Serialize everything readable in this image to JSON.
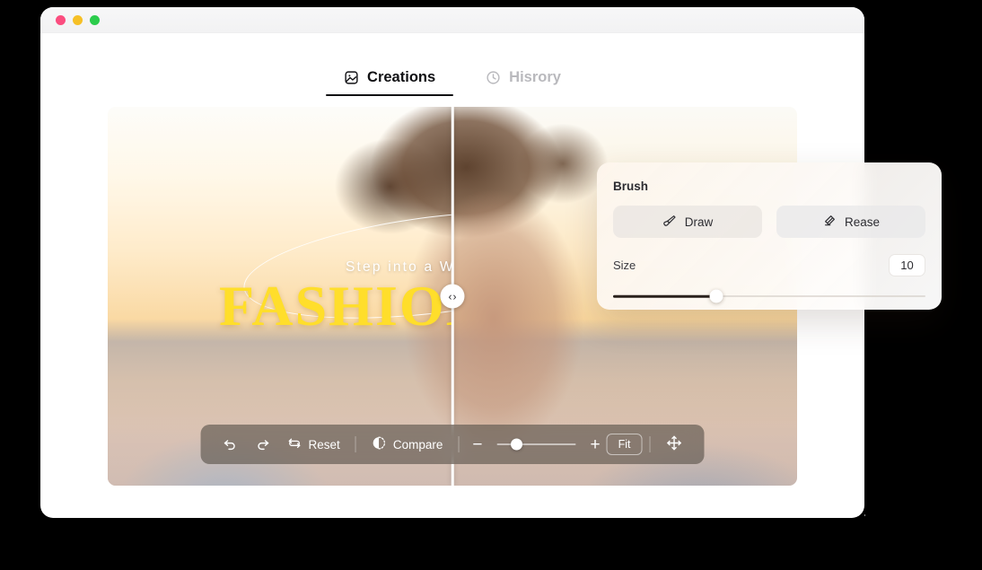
{
  "window": {
    "traffic_lights": [
      {
        "name": "close",
        "color": "#fb4d7f"
      },
      {
        "name": "minimize",
        "color": "#f6c026"
      },
      {
        "name": "maximize",
        "color": "#2bcc4c"
      }
    ]
  },
  "tabs": [
    {
      "id": "creations",
      "label": "Creations",
      "icon": "image-icon",
      "active": true
    },
    {
      "id": "history",
      "label": "Hisrory",
      "icon": "clock-icon",
      "active": false
    }
  ],
  "canvas": {
    "overlay_subtitle": "Step into a W",
    "overlay_title": "FASHION",
    "overlay_title_color": "#ffde2b",
    "compare_handle_left": "‹",
    "compare_handle_right": "›",
    "divider_position_percent": 50
  },
  "toolbar": {
    "undo_label": "",
    "redo_label": "",
    "reset_label": "Reset",
    "compare_label": "Compare",
    "zoom_out_label": "−",
    "zoom_in_label": "+",
    "fit_label": "Fit",
    "zoom_slider_percent": 25
  },
  "brush_panel": {
    "title": "Brush",
    "draw_label": "Draw",
    "erase_label": "Rease",
    "size_label": "Size",
    "size_value": "10",
    "size_slider_percent": 33
  }
}
